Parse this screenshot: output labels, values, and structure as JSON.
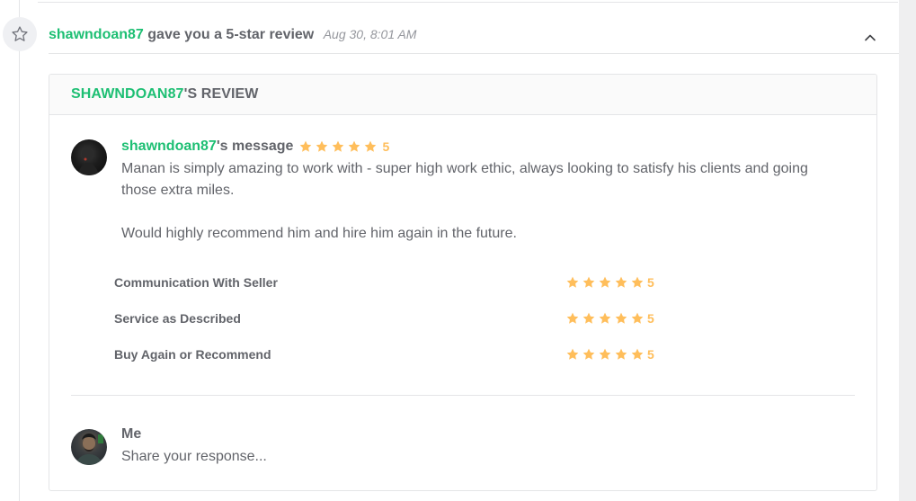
{
  "notification": {
    "username": "shawndoan87",
    "action": "gave you a 5-star review",
    "date": "Aug 30, 8:01 AM",
    "icon": "star-outline-icon",
    "collapse_icon": "chevron-up-icon"
  },
  "review": {
    "title_username": "SHAWNDOAN87",
    "title_suffix": "'S REVIEW",
    "message_username": "shawndoan87",
    "message_suffix": "'s message",
    "overall_rating": "5",
    "body": [
      "Manan is simply amazing to work with - super high work ethic, always looking to satisfy his clients and going those extra miles.",
      "Would highly recommend him and hire him again in the future."
    ],
    "criteria": [
      {
        "label": "Communication With Seller",
        "rating": "5"
      },
      {
        "label": "Service as Described",
        "rating": "5"
      },
      {
        "label": "Buy Again or Recommend",
        "rating": "5"
      }
    ]
  },
  "response": {
    "name": "Me",
    "placeholder": "Share your response..."
  },
  "colors": {
    "brand_green": "#1dbf73",
    "star_orange": "#ffbe5b",
    "text_gray": "#62646a"
  }
}
